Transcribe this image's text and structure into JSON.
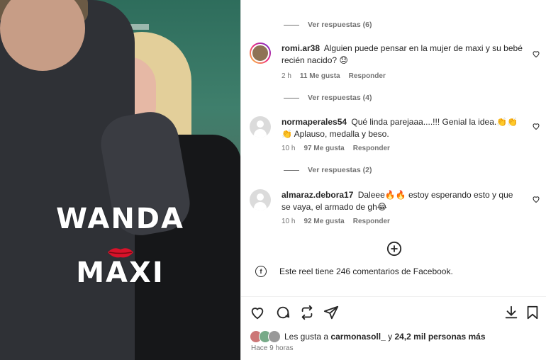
{
  "media": {
    "title_line1": "WANDA",
    "title_line2": "MAXI",
    "lips_icon": "lips-icon",
    "colors": {
      "lips": "#d9122a",
      "title": "#ffffff"
    }
  },
  "comments": [
    {
      "view_replies": "Ver respuestas (6)"
    },
    {
      "username": "romi.ar38",
      "text": "Alguien puede pensar en la mujer de maxi y su bebé recién nacido? 😓",
      "time": "2 h",
      "likes": "11 Me gusta",
      "reply": "Responder",
      "view_replies": "Ver respuestas (4)"
    },
    {
      "username": "normaperales54",
      "text": "Qué linda parejaaa....!!! Genial la idea.👏👏 👏 Aplauso, medalla y beso.",
      "time": "10 h",
      "likes": "97 Me gusta",
      "reply": "Responder",
      "view_replies": "Ver respuestas (2)"
    },
    {
      "username": "almaraz.debora17",
      "text": "Daleee🔥🔥 estoy esperando esto y que se vaya, el armado de gh😂",
      "time": "10 h",
      "likes": "92 Me gusta",
      "reply": "Responder"
    }
  ],
  "facebook_note": "Este reel tiene 246 comentarios de Facebook.",
  "footer": {
    "liked_prefix": "Les gusta a",
    "liked_user": "carmonasoll_",
    "liked_suffix": "y",
    "liked_count": "24,2 mil personas más",
    "time_ago": "Hace 9 horas"
  },
  "icons": [
    "heart-icon",
    "comment-icon",
    "repost-icon",
    "share-icon",
    "download-icon",
    "bookmark-icon",
    "add-circle-icon",
    "facebook-icon"
  ]
}
